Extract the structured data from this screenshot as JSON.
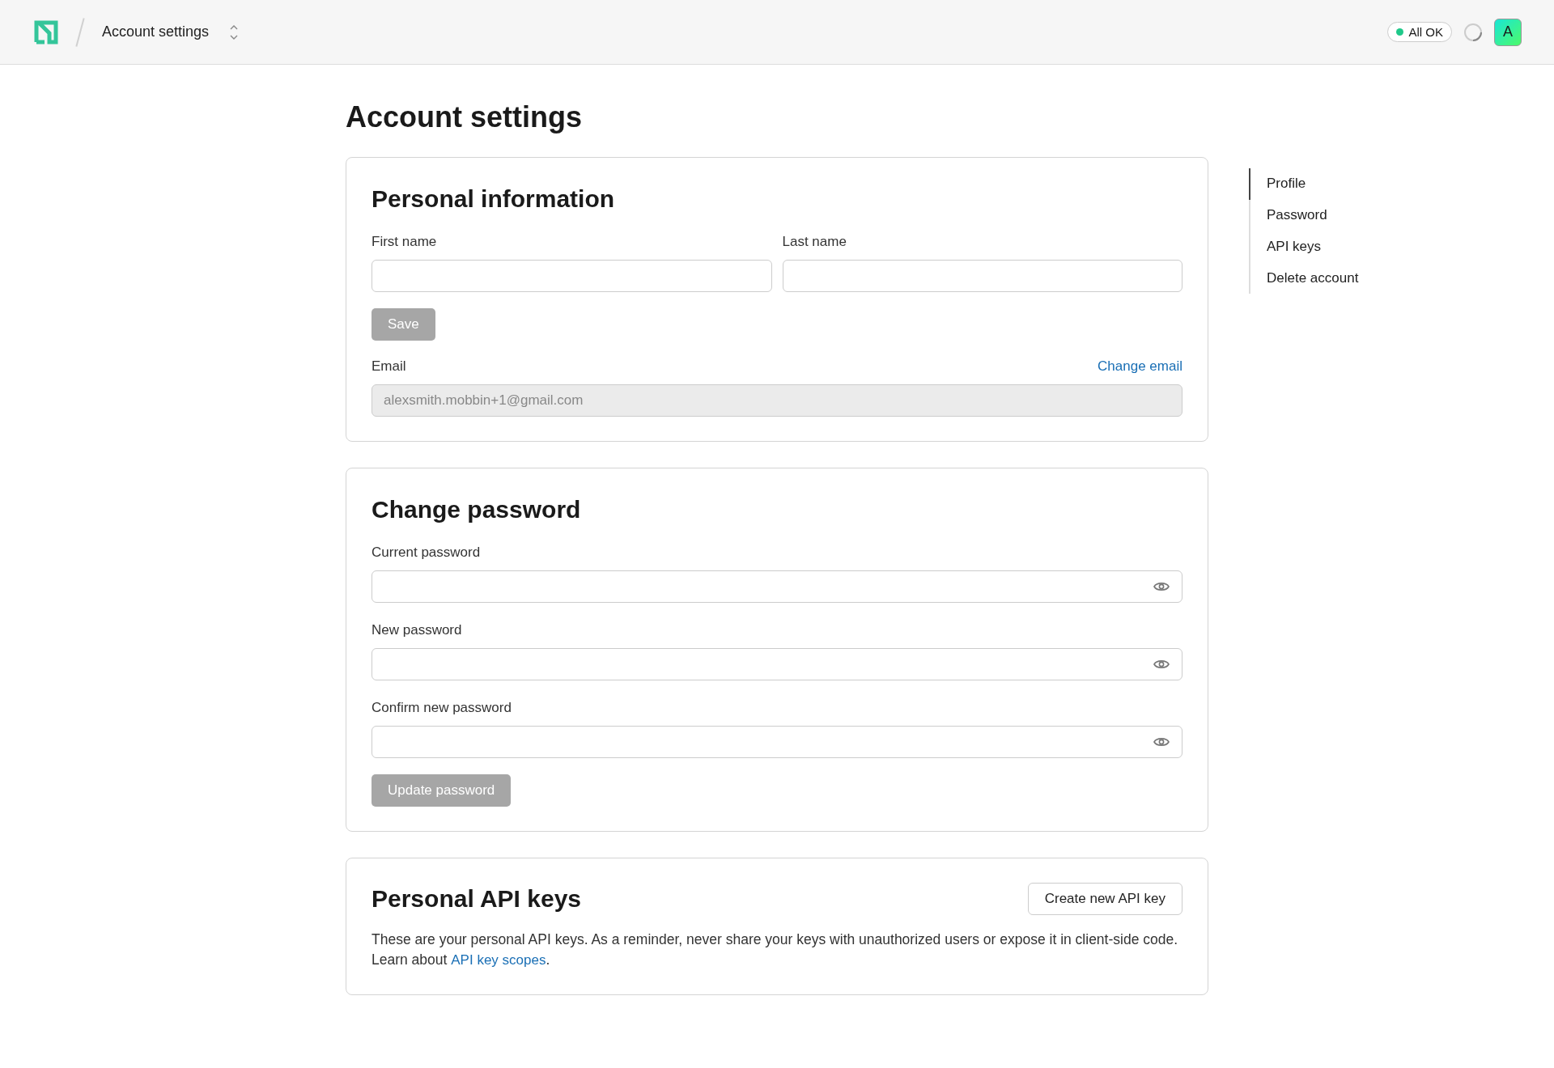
{
  "header": {
    "breadcrumb": "Account settings",
    "status": {
      "label": "All OK",
      "color": "#1fc98a"
    },
    "avatar": "A"
  },
  "page_title": "Account settings",
  "personal_information": {
    "title": "Personal information",
    "fields": [
      {
        "label": "First name"
      },
      {
        "label": "Last name"
      }
    ],
    "save_button": {
      "label": "Save",
      "disabled": true
    },
    "email": {
      "label": "Email",
      "link": "Change email",
      "value": "alexsmith.mobbin+1@gmail.com",
      "disabled": true
    }
  },
  "change_password": {
    "title": "Change password",
    "fields": [
      {
        "label": "Current password"
      },
      {
        "label": "New password"
      },
      {
        "label": "Confirm new password"
      }
    ],
    "update_button": {
      "label": "Update password",
      "disabled": true
    }
  },
  "api_keys": {
    "title": "Personal API keys",
    "create_button": "Create new API key",
    "description": "These are your personal API keys. As a reminder, never share your keys with unauthorized users or expose it in client-side code. Learn about ",
    "link": "API key scopes",
    "after_link": "."
  },
  "nav": [
    {
      "label": "Profile",
      "selected": true
    },
    {
      "label": "Password",
      "selected": false
    },
    {
      "label": "API keys",
      "selected": false
    },
    {
      "label": "Delete account",
      "selected": false
    }
  ]
}
